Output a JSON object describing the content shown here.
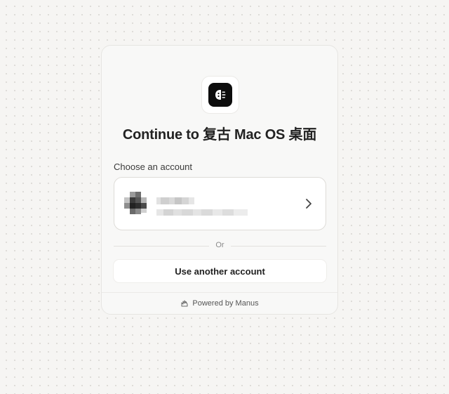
{
  "dialog": {
    "title": "Continue to 复古 Mac OS 桌面",
    "choose_label": "Choose an account",
    "or_label": "Or",
    "use_another_label": "Use another account",
    "footer_text": "Powered by Manus"
  },
  "icons": {
    "app": "app-logo-icon",
    "chevron": "chevron-right-icon",
    "footer": "manus-logo-icon"
  },
  "colors": {
    "background": "#f6f5f3",
    "card": "#f8f8f7",
    "app_icon": "#0d0d0d"
  }
}
